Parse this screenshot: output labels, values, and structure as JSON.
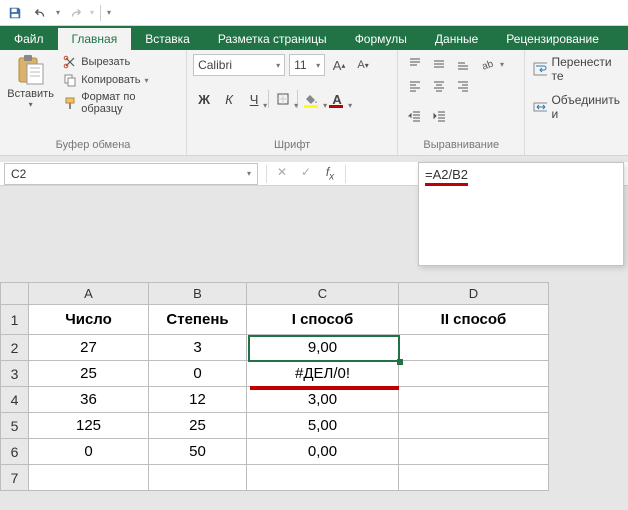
{
  "titlebar": {
    "save": "save",
    "undo": "undo",
    "redo": "redo"
  },
  "tabs": [
    "Файл",
    "Главная",
    "Вставка",
    "Разметка страницы",
    "Формулы",
    "Данные",
    "Рецензирование"
  ],
  "active_tab": 1,
  "clipboard": {
    "paste_label": "Вставить",
    "cut": "Вырезать",
    "copy": "Копировать",
    "format_painter": "Формат по образцу",
    "group_label": "Буфер обмена"
  },
  "font": {
    "name": "Calibri",
    "size": "11",
    "group_label": "Шрифт",
    "fill_color": "#ffff00",
    "font_color": "#c00000"
  },
  "alignment": {
    "wrap": "Перенести те",
    "merge": "Объединить и",
    "group_label": "Выравнивание"
  },
  "namebox": "C2",
  "formula": "=A2/B2",
  "columns": [
    "A",
    "B",
    "C",
    "D"
  ],
  "rows": [
    "1",
    "2",
    "3",
    "4",
    "5",
    "6",
    "7"
  ],
  "headers": [
    "Число",
    "Степень",
    "I способ",
    "II способ"
  ],
  "data": [
    [
      "27",
      "3",
      "9,00",
      ""
    ],
    [
      "25",
      "0",
      "#ДЕЛ/0!",
      ""
    ],
    [
      "36",
      "12",
      "3,00",
      ""
    ],
    [
      "125",
      "25",
      "5,00",
      ""
    ],
    [
      "0",
      "50",
      "0,00",
      ""
    ]
  ],
  "selected_cell": "C2"
}
